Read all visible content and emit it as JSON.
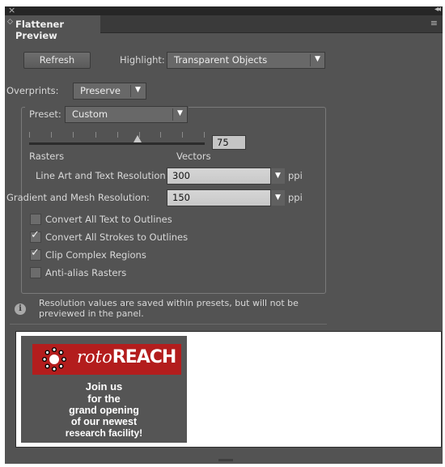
{
  "panel": {
    "close_glyph": "×",
    "collapse_glyph": "◂◂",
    "tab_title": "Flattener Preview",
    "tab_arrow": "◇",
    "menu_icon": "≡"
  },
  "top_controls": {
    "refresh_label": "Refresh",
    "highlight_label": "Highlight:",
    "highlight_value": "Transparent Objects"
  },
  "overprints": {
    "label": "Overprints:",
    "value": "Preserve"
  },
  "preset": {
    "label": "Preset:",
    "value": "Custom",
    "slider_value": "75",
    "slider_level_percent": 75,
    "rasters_label": "Rasters",
    "vectors_label": "Vectors",
    "line_art_label": "Line Art and Text Resolution:",
    "line_art_value": "300",
    "line_art_unit": "ppi",
    "gradient_label": "Gradient and Mesh Resolution:",
    "gradient_value": "150",
    "gradient_unit": "ppi",
    "checkboxes": [
      {
        "label": "Convert All Text to Outlines",
        "checked": false
      },
      {
        "label": "Convert All Strokes to Outlines",
        "checked": true
      },
      {
        "label": "Clip Complex Regions",
        "checked": true
      },
      {
        "label": "Anti-alias Rasters",
        "checked": false
      }
    ]
  },
  "info": {
    "icon": "info-icon",
    "line1": "Resolution values are saved within presets, but will not be",
    "line2": "previewed in the panel."
  },
  "preview": {
    "logo_italic": "roto",
    "logo_bold": "REACH",
    "lines": [
      "Join us",
      "for the",
      "grand opening",
      "of our newest",
      "research facility!"
    ]
  },
  "colors": {
    "panel_bg": "#535353",
    "logo_red": "#b31d1d"
  }
}
